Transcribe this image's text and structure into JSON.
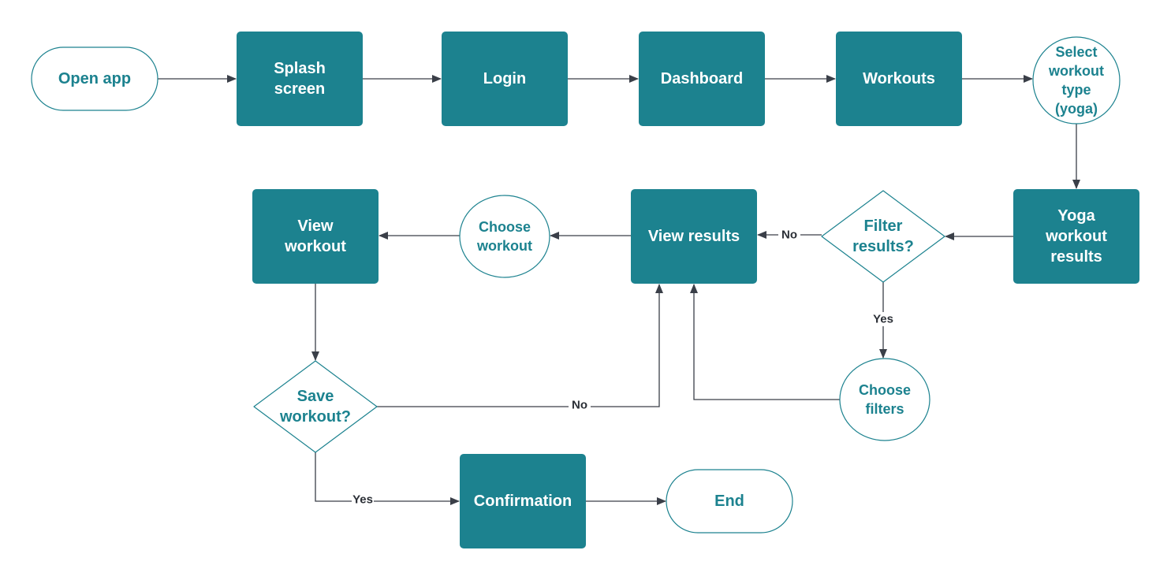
{
  "colors": {
    "process_fill": "#1c828f",
    "process_text": "#ffffff",
    "outline_stroke": "#1c828f",
    "outline_text": "#1c828f",
    "connector": "#3a3f48"
  },
  "nodes": {
    "open_app": {
      "type": "terminal",
      "lines": [
        "Open app"
      ]
    },
    "splash": {
      "type": "process",
      "lines": [
        "Splash",
        "screen"
      ]
    },
    "login": {
      "type": "process",
      "lines": [
        "Login"
      ]
    },
    "dashboard": {
      "type": "process",
      "lines": [
        "Dashboard"
      ]
    },
    "workouts": {
      "type": "process",
      "lines": [
        "Workouts"
      ]
    },
    "select_type": {
      "type": "circle",
      "lines": [
        "Select",
        "workout",
        "type",
        "(yoga)"
      ]
    },
    "yoga_results": {
      "type": "process",
      "lines": [
        "Yoga",
        "workout",
        "results"
      ]
    },
    "filter_decision": {
      "type": "decision",
      "lines": [
        "Filter",
        "results?"
      ]
    },
    "view_results": {
      "type": "process",
      "lines": [
        "View results"
      ]
    },
    "choose_workout": {
      "type": "circle",
      "lines": [
        "Choose",
        "workout"
      ]
    },
    "view_workout": {
      "type": "process",
      "lines": [
        "View",
        "workout"
      ]
    },
    "choose_filters": {
      "type": "circle",
      "lines": [
        "Choose",
        "filters"
      ]
    },
    "save_decision": {
      "type": "decision",
      "lines": [
        "Save",
        "workout?"
      ]
    },
    "confirmation": {
      "type": "process",
      "lines": [
        "Confirmation"
      ]
    },
    "end": {
      "type": "terminal",
      "lines": [
        "End"
      ]
    }
  },
  "edges": [
    {
      "from": "open_app",
      "to": "splash",
      "label": ""
    },
    {
      "from": "splash",
      "to": "login",
      "label": ""
    },
    {
      "from": "login",
      "to": "dashboard",
      "label": ""
    },
    {
      "from": "dashboard",
      "to": "workouts",
      "label": ""
    },
    {
      "from": "workouts",
      "to": "select_type",
      "label": ""
    },
    {
      "from": "select_type",
      "to": "yoga_results",
      "label": ""
    },
    {
      "from": "yoga_results",
      "to": "filter_decision",
      "label": ""
    },
    {
      "from": "filter_decision",
      "to": "view_results",
      "label": "No"
    },
    {
      "from": "filter_decision",
      "to": "choose_filters",
      "label": "Yes"
    },
    {
      "from": "choose_filters",
      "to": "view_results",
      "label": ""
    },
    {
      "from": "view_results",
      "to": "choose_workout",
      "label": ""
    },
    {
      "from": "choose_workout",
      "to": "view_workout",
      "label": ""
    },
    {
      "from": "view_workout",
      "to": "save_decision",
      "label": ""
    },
    {
      "from": "save_decision",
      "to": "view_results",
      "label": "No"
    },
    {
      "from": "save_decision",
      "to": "confirmation",
      "label": "Yes"
    },
    {
      "from": "confirmation",
      "to": "end",
      "label": ""
    }
  ]
}
